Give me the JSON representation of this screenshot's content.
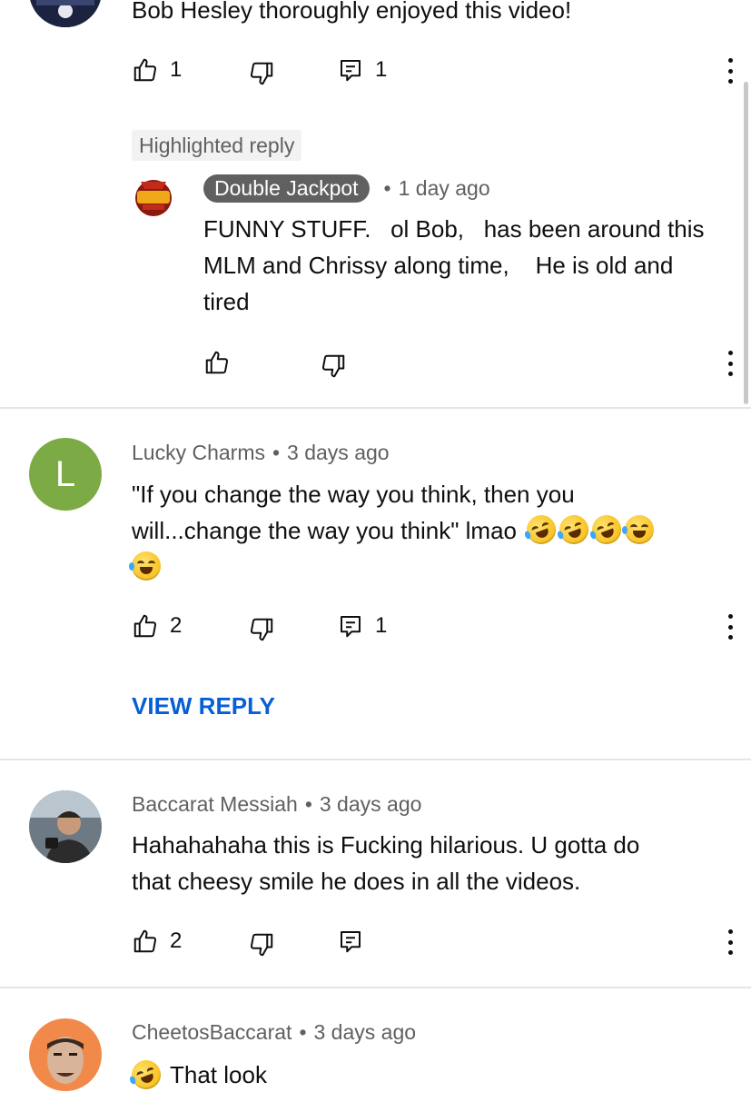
{
  "comment1": {
    "text": "Bob Hesley thoroughly enjoyed this video!",
    "like_count": "1",
    "reply_count": "1"
  },
  "highlighted": {
    "badge": "Highlighted reply",
    "author": "Double Jackpot",
    "time": "1 day ago",
    "lines": [
      "FUNNY STUFF.   ol Bob,   has been around this",
      "MLM and Chrissy along time,    He is old and",
      "tired"
    ],
    "avatar_text": "DOUBLE JACKPOT"
  },
  "comment2": {
    "avatar_letter": "L",
    "avatar_color": "#7cab45",
    "author": "Lucky Charms",
    "time": "3 days ago",
    "line1": "\"If you change the way you think, then you",
    "line2": "will...change the way you think\" lmao",
    "like_count": "2",
    "reply_count": "1",
    "view_reply": "VIEW REPLY"
  },
  "comment3": {
    "author": "Baccarat Messiah",
    "time": "3 days ago",
    "line1": "Hahahahaha this is Fucking hilarious. U gotta do",
    "line2": "that cheesy smile he does in all the videos.",
    "like_count": "2"
  },
  "comment4": {
    "author": "CheetosBaccarat",
    "time": "3 days ago",
    "text": "That look"
  },
  "colors": {
    "link_blue": "#065fd4",
    "meta_gray": "#606060",
    "badge_bg": "#f2f2f2"
  },
  "icons": [
    "thumb-up-icon",
    "thumb-down-icon",
    "reply-icon",
    "more-vert-icon",
    "rofl-emoji",
    "joy-emoji"
  ]
}
